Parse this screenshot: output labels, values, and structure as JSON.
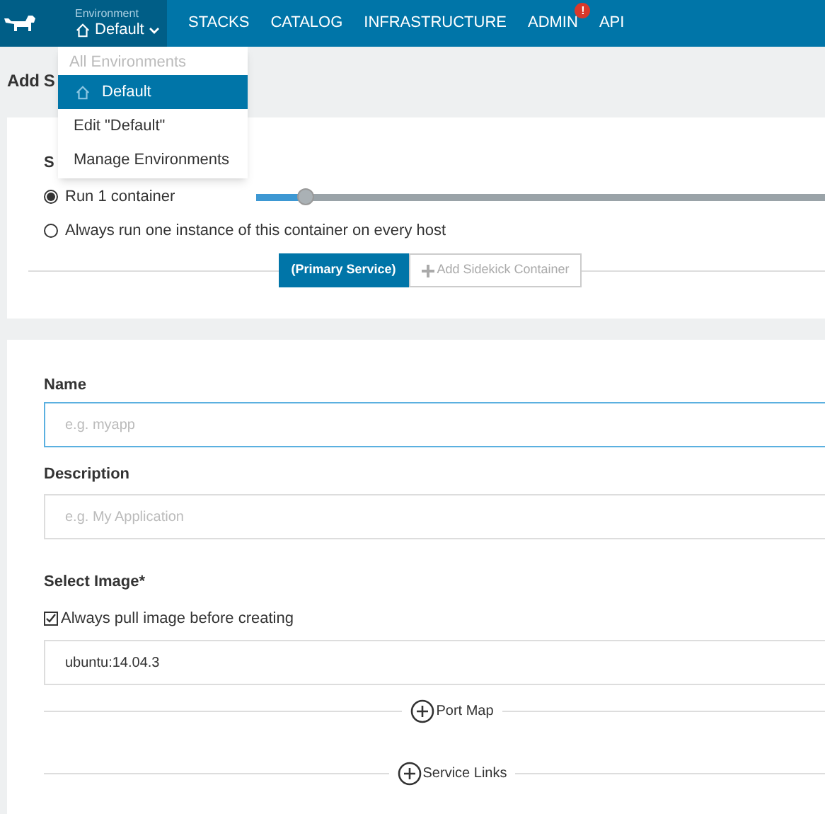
{
  "header": {
    "environment_label": "Environment",
    "environment": "Default",
    "nav": [
      {
        "label": "STACKS",
        "alert": false
      },
      {
        "label": "CATALOG",
        "alert": false
      },
      {
        "label": "INFRASTRUCTURE",
        "alert": false
      },
      {
        "label": "ADMIN",
        "alert": true,
        "badge": "!"
      },
      {
        "label": "API",
        "alert": false
      }
    ]
  },
  "env_menu": {
    "heading": "All Environments",
    "items": [
      {
        "label": "Default",
        "selected": true,
        "kind": "environment"
      },
      {
        "label": "Edit \"Default\"",
        "selected": false,
        "kind": "action"
      },
      {
        "label": "Manage Environments",
        "selected": false,
        "kind": "action"
      }
    ]
  },
  "page_title": "Add S",
  "scale": {
    "label": "S",
    "options": [
      {
        "label": "Run 1 container",
        "selected": true
      },
      {
        "label": "Always run one instance of this container on every host",
        "selected": false
      }
    ],
    "level": 0.08
  },
  "container_tabs": [
    {
      "label": "(Primary Service)",
      "selected": true,
      "kind": "tab"
    },
    {
      "label": "Add Sidekick Container",
      "selected": false,
      "kind": "add"
    }
  ],
  "form": {
    "name": {
      "label": "Name",
      "placeholder": "e.g. myapp",
      "focused": true
    },
    "description": {
      "label": "Description",
      "placeholder": "e.g. My Application",
      "focused": false
    },
    "image": {
      "label": "Select Image*",
      "pull_label": "Always pull image before creating",
      "pull_checked": true,
      "value": "ubuntu:14.04.3"
    }
  },
  "sections": [
    "Port Map",
    "Service Links"
  ]
}
